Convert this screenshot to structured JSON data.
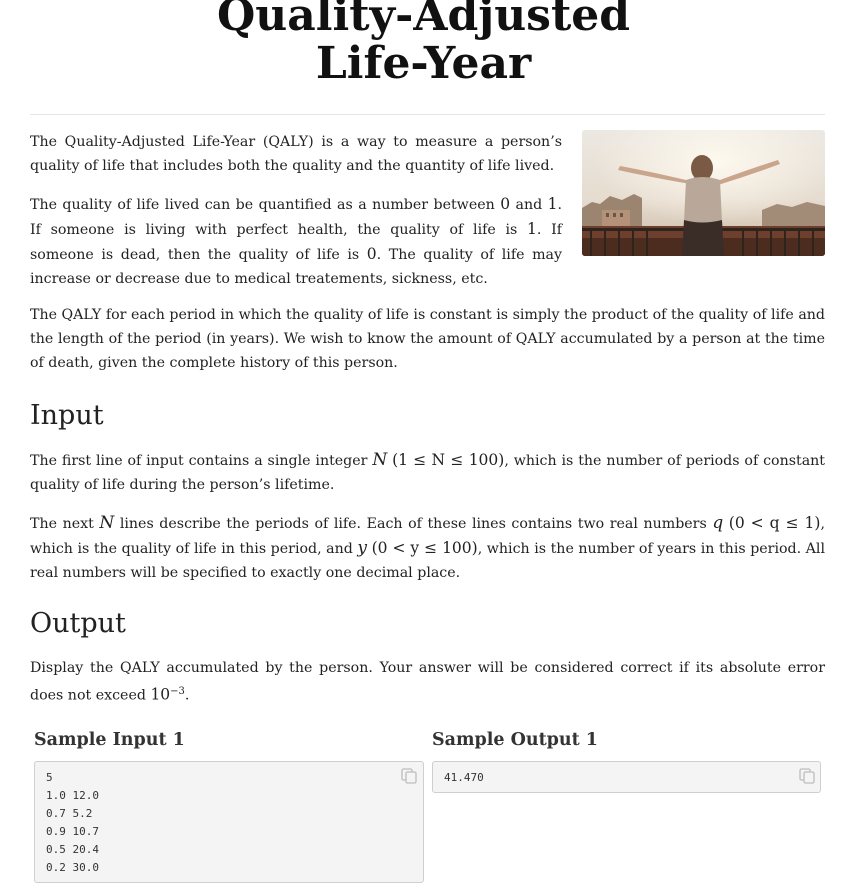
{
  "title": {
    "line1": "Quality-Adjusted",
    "line2": "Life-Year"
  },
  "intro": {
    "p1": "The Quality-Adjusted Life-Year (QALY) is a way to measure a person’s quality of life that includes both the quality and the quantity of life lived.",
    "p2": {
      "a": "The quality of life lived can be quantified as a number between ",
      "zero1": "0",
      "b": " and ",
      "one1": "1",
      "c": ". If someone is living with perfect health, the quality of life is ",
      "one2": "1",
      "d": ". If someone is dead, then the quality of life is ",
      "zero2": "0",
      "e": ". The quality of life may increase or decrease due to medical treatements, sickness, etc."
    },
    "p3": "The QALY for each period in which the quality of life is constant is simply the product of the quality of life and the length of the period (in years). We wish to know the amount of QALY accumulated by a person at the time of death, given the complete history of this person."
  },
  "input_section": {
    "heading": "Input",
    "p1": {
      "a": "The first line of input contains a single integer ",
      "var": "N",
      "range": "(1 ≤ N ≤ 100)",
      "b": ", which is the number of periods of constant quality of life during the person’s lifetime."
    },
    "p2": {
      "a": "The next ",
      "var": "N",
      "b": " lines describe the periods of life. Each of these lines contains two real numbers ",
      "q": "q",
      "q_range": "(0 < q ≤ 1)",
      "c": ", which is the quality of life in this period, and ",
      "y": "y",
      "y_range": "(0 < y ≤ 100)",
      "d": ", which is the number of years in this period. All real numbers will be specified to exactly one decimal place."
    }
  },
  "output_section": {
    "heading": "Output",
    "p1": {
      "a": "Display the QALY accumulated by the person. Your answer will be considered correct if its absolute error does not exceed ",
      "base": "10",
      "exp": "−3",
      "b": "."
    }
  },
  "samples": {
    "input_title": "Sample Input 1",
    "input_text": "5\n1.0 12.0\n0.7 5.2\n0.9 10.7\n0.5 20.4\n0.2 30.0",
    "output_title": "Sample Output 1",
    "output_text": "41.470",
    "copy_icon": "copy-icon"
  }
}
